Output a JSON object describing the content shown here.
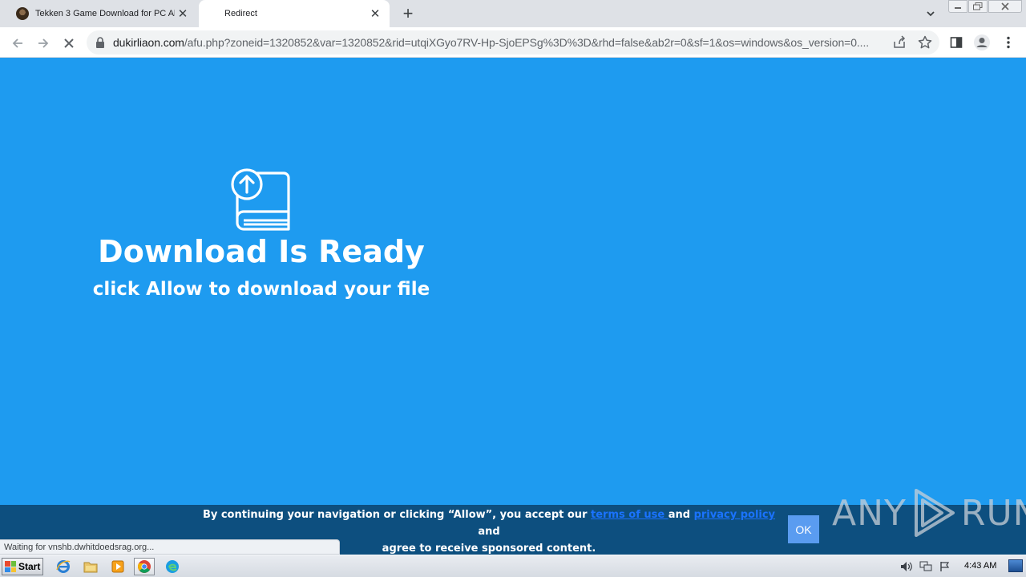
{
  "browser": {
    "tabs": [
      {
        "title": "Tekken 3 Game Download for PC All V",
        "active": false
      },
      {
        "title": "Redirect",
        "active": true
      }
    ],
    "new_tab_label": "+",
    "close_glyph": "✕",
    "url_host": "dukirliaon.com",
    "url_path": "/afu.php?zoneid=1320852&var=1320852&rid=utqiXGyo7RV-Hp-SjoEPSg%3D%3D&rhd=false&ab2r=0&sf=1&os=windows&os_version=0...."
  },
  "page": {
    "headline": "Download Is Ready",
    "subline": "click Allow to download your file",
    "background_color": "#1e9bf0"
  },
  "consent": {
    "text_before": "By continuing your navigation or clicking “Allow”, you accept our ",
    "terms_link": "terms of use ",
    "text_and1": "and ",
    "privacy_link": "privacy policy ",
    "text_and2": "and",
    "text_line2": "agree to receive sponsored content.",
    "ok_button": "OK"
  },
  "watermark": {
    "left": "ANY",
    "right": "RUN"
  },
  "status_bar": "Waiting for vnshb.dwhitdoedsrag.org...",
  "taskbar": {
    "start_label": "Start",
    "clock": "4:43 AM"
  }
}
